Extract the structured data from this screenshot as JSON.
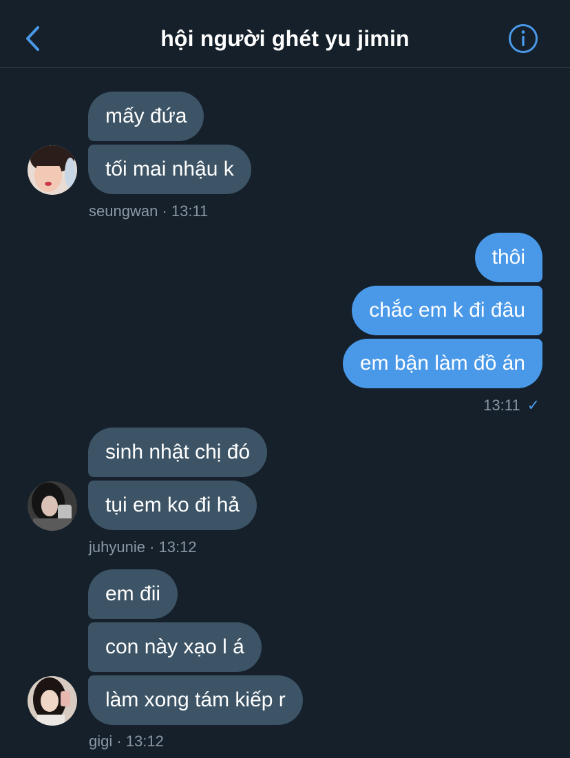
{
  "header": {
    "title": "hội người ghét yu jimin",
    "back_icon": "chevron-left-icon",
    "info_icon": "info-circle-icon",
    "accent": "#4a99e9"
  },
  "messages": {
    "group1": {
      "m1": "mấy đứa",
      "m2": "tối mai nhậu k",
      "meta": "seungwan · 13:11"
    },
    "group2": {
      "m1": "thôi",
      "m2": "chắc em k đi đâu",
      "m3": "em bận làm đồ án",
      "time": "13:11",
      "check": "✓"
    },
    "group3": {
      "m1": "sinh nhật chị đó",
      "m2": "tụi em ko đi hả",
      "meta": "juhyunie · 13:12"
    },
    "group4": {
      "m1": "em đii",
      "m2": "con này xạo l á",
      "m3": "làm xong tám kiếp r",
      "meta": "gigi · 13:12"
    }
  },
  "colors": {
    "background": "#15202b",
    "incoming_bubble": "#3d5466",
    "outgoing_bubble": "#4a99e9",
    "meta_text": "#8b98a5"
  }
}
